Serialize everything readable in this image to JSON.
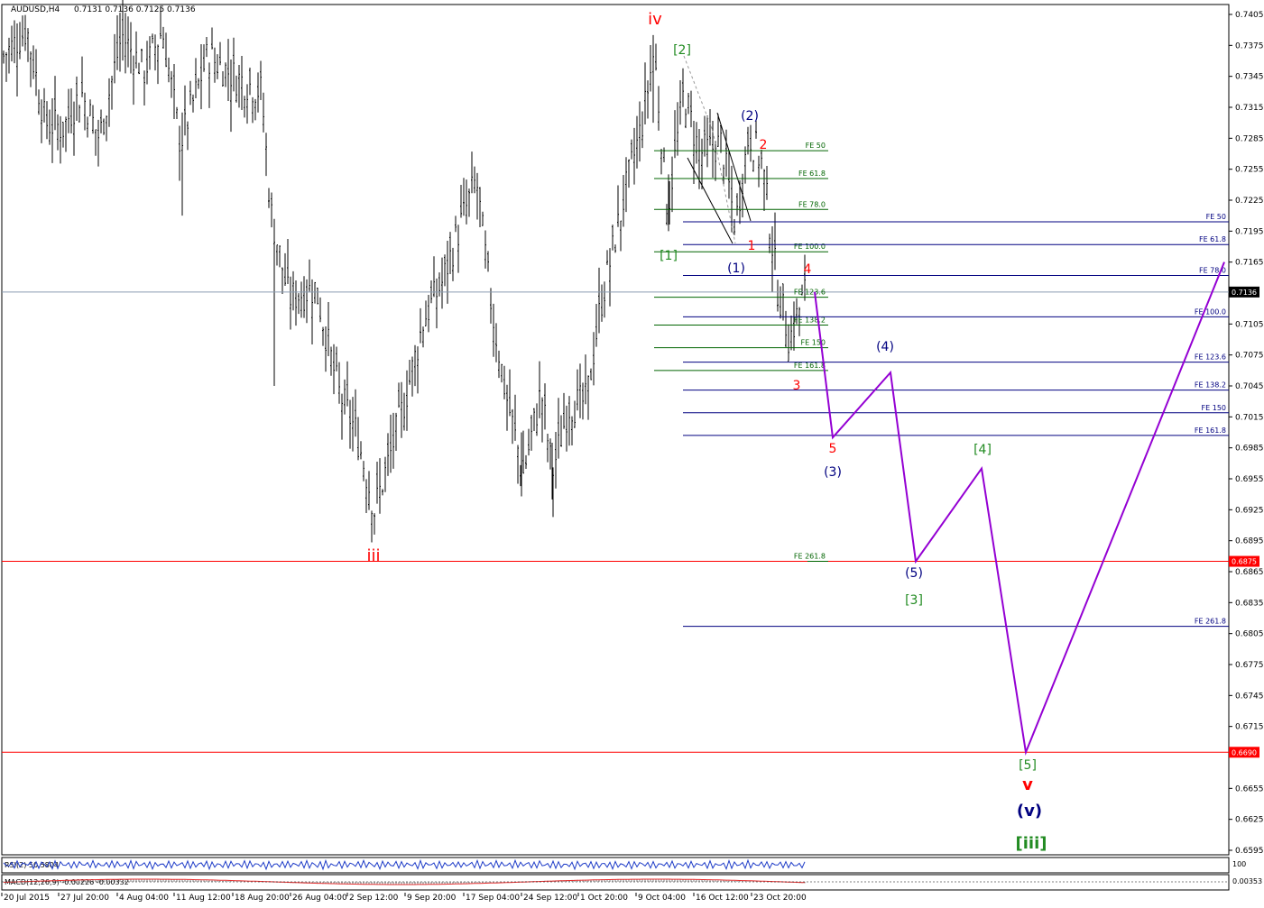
{
  "chart_data": {
    "type": "candlestick-ohlc",
    "header": {
      "symbol": "AUDUSD,H4",
      "values": "0.7131 0.7136 0.7125 0.7136"
    },
    "y_axis": {
      "min": 0.6595,
      "max": 0.7405,
      "ticks": [
        "0.7405",
        "0.7375",
        "0.7345",
        "0.7315",
        "0.7285",
        "0.7255",
        "0.7225",
        "0.7195",
        "0.7165",
        "0.7136",
        "0.7105",
        "0.7075",
        "0.7045",
        "0.7015",
        "0.6985",
        "0.6955",
        "0.6925",
        "0.6895",
        "0.6875",
        "0.6865",
        "0.6835",
        "0.6805",
        "0.6775",
        "0.6745",
        "0.6715",
        "0.6690",
        "0.6655",
        "0.6625",
        "0.6595"
      ]
    },
    "x_axis": {
      "labels": [
        "20 Jul 2015",
        "27 Jul 20:00",
        "4 Aug 04:00",
        "11 Aug 12:00",
        "18 Aug 20:00",
        "26 Aug 04:00",
        "2 Sep 12:00",
        "9 Sep 20:00",
        "17 Sep 04:00",
        "24 Sep 12:00",
        "1 Oct 20:00",
        "9 Oct 04:00",
        "16 Oct 12:00",
        "23 Oct 20:00"
      ]
    },
    "current_price": "0.7136",
    "horizontal_levels": [
      {
        "price": 0.6875,
        "label": "0.6875",
        "color": "#ff0000"
      },
      {
        "price": 0.669,
        "label": "0.6690",
        "color": "#ff0000"
      }
    ],
    "fib_green": [
      {
        "label": "FE 50",
        "price": 0.7273
      },
      {
        "label": "FE 61.8",
        "price": 0.7246
      },
      {
        "label": "FE 78.0",
        "price": 0.7216
      },
      {
        "label": "FE 100.0",
        "price": 0.7175
      },
      {
        "label": "FE 123.6",
        "price": 0.7131
      },
      {
        "label": "FE 138.2",
        "price": 0.7104
      },
      {
        "label": "FE 150",
        "price": 0.7082
      },
      {
        "label": "FE 161.8",
        "price": 0.706
      },
      {
        "label": "FE 261.8",
        "price": 0.6875
      }
    ],
    "fib_blue": [
      {
        "label": "FE 50",
        "price": 0.7204
      },
      {
        "label": "FE 61.8",
        "price": 0.7182
      },
      {
        "label": "FE 78.0",
        "price": 0.7152
      },
      {
        "label": "FE 100.0",
        "price": 0.7112
      },
      {
        "label": "FE 123.6",
        "price": 0.7068
      },
      {
        "label": "FE 138.2",
        "price": 0.7041
      },
      {
        "label": "FE 150",
        "price": 0.7019
      },
      {
        "label": "FE 161.8",
        "price": 0.6997
      },
      {
        "label": "FE 261.8",
        "price": 0.6812
      }
    ],
    "wave_labels": [
      {
        "text": "iv",
        "color": "#ff0000"
      },
      {
        "text": "iii",
        "color": "#ff0000"
      },
      {
        "text": "[2]",
        "color": "#228b22"
      },
      {
        "text": "[1]",
        "color": "#228b22"
      },
      {
        "text": "(2)",
        "color": "#000080"
      },
      {
        "text": "(1)",
        "color": "#000080"
      },
      {
        "text": "2",
        "color": "#ff0000"
      },
      {
        "text": "1",
        "color": "#ff0000"
      },
      {
        "text": "4",
        "color": "#ff0000"
      },
      {
        "text": "3",
        "color": "#ff0000"
      },
      {
        "text": "5",
        "color": "#ff0000"
      },
      {
        "text": "(3)",
        "color": "#000080"
      },
      {
        "text": "(4)",
        "color": "#000080"
      },
      {
        "text": "[4]",
        "color": "#228b22"
      },
      {
        "text": "(5)",
        "color": "#000080"
      },
      {
        "text": "[3]",
        "color": "#228b22"
      },
      {
        "text": "[5]",
        "color": "#228b22"
      },
      {
        "text": "v",
        "color": "#ff0000"
      },
      {
        "text": "(v)",
        "color": "#000080"
      },
      {
        "text": "[iii]",
        "color": "#228b22"
      }
    ],
    "projection_path_prices": [
      0.7136,
      0.6995,
      0.7058,
      0.6875,
      0.6965,
      0.669,
      0.7165
    ],
    "indicators": {
      "rsi": "RSI(2) 50.5804",
      "rsi_scale": "100",
      "macd": "MACD(12,26,9) -0.00226 -0.00332",
      "macd_scale": "0.00353"
    }
  }
}
